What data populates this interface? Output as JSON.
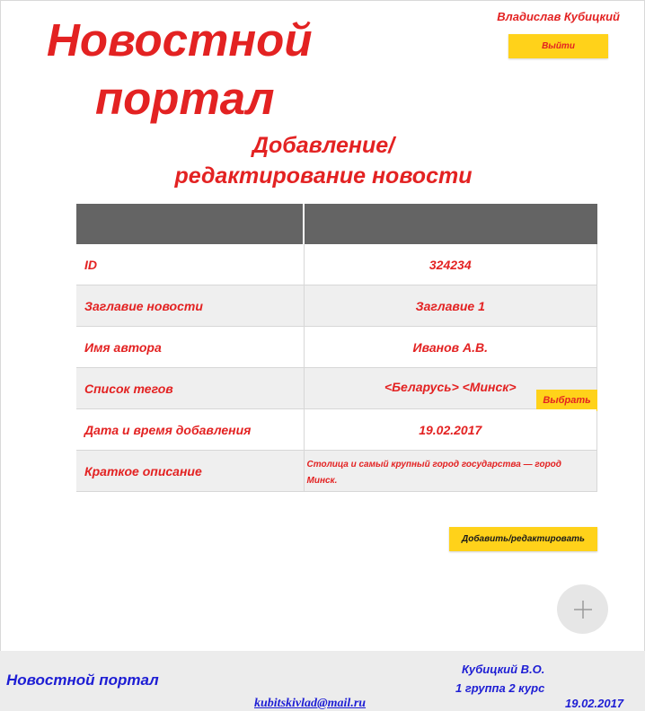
{
  "header": {
    "site_title_line1": "Новостной",
    "site_title_line2": "портал",
    "username": "Владислав Кубицкий",
    "logout_label": "Выйти"
  },
  "main": {
    "heading_line1": "Добавление/",
    "heading_line2": "редактирование новости",
    "fields": [
      {
        "label": "ID",
        "value": "324234"
      },
      {
        "label": "Заглавие новости",
        "value": "Заглавие 1"
      },
      {
        "label": "Имя автора",
        "value": "Иванов А.В."
      },
      {
        "label": "Список тегов",
        "value": "<Беларусь> <Минск>"
      },
      {
        "label": "Дата и время добавления",
        "value": "19.02.2017"
      },
      {
        "label": "Краткое описание",
        "value": "Столица и самый крупный город государства — город Минск."
      }
    ],
    "choose_label": "Выбрать",
    "submit_label": "Добавить/редактировать",
    "fab_icon": "plus-icon"
  },
  "footer": {
    "title": "Новостной портал",
    "author": "Кубицкий В.О.",
    "group": "1 группа 2 курс",
    "email": "kubitskivlad@mail.ru",
    "date": "19.02.2017"
  },
  "colors": {
    "accent_red": "#e32222",
    "button_yellow": "#ffd21a",
    "footer_blue": "#1d1dd4",
    "table_header": "#646464"
  }
}
